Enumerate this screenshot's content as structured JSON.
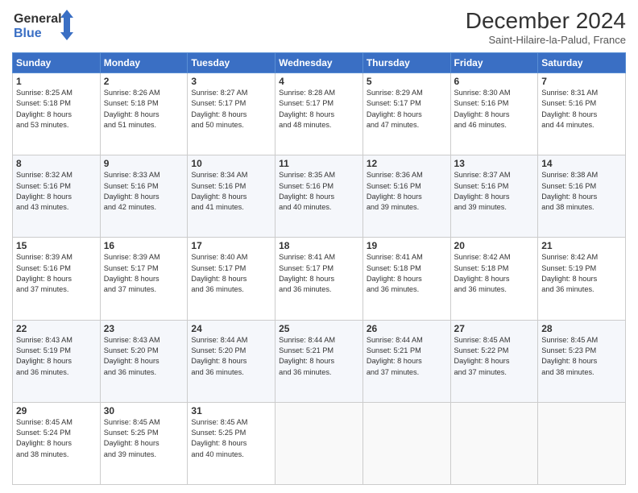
{
  "header": {
    "logo_line1": "General",
    "logo_line2": "Blue",
    "month": "December 2024",
    "location": "Saint-Hilaire-la-Palud, France"
  },
  "days_of_week": [
    "Sunday",
    "Monday",
    "Tuesday",
    "Wednesday",
    "Thursday",
    "Friday",
    "Saturday"
  ],
  "weeks": [
    [
      {
        "day": "1",
        "info": "Sunrise: 8:25 AM\nSunset: 5:18 PM\nDaylight: 8 hours\nand 53 minutes."
      },
      {
        "day": "2",
        "info": "Sunrise: 8:26 AM\nSunset: 5:18 PM\nDaylight: 8 hours\nand 51 minutes."
      },
      {
        "day": "3",
        "info": "Sunrise: 8:27 AM\nSunset: 5:17 PM\nDaylight: 8 hours\nand 50 minutes."
      },
      {
        "day": "4",
        "info": "Sunrise: 8:28 AM\nSunset: 5:17 PM\nDaylight: 8 hours\nand 48 minutes."
      },
      {
        "day": "5",
        "info": "Sunrise: 8:29 AM\nSunset: 5:17 PM\nDaylight: 8 hours\nand 47 minutes."
      },
      {
        "day": "6",
        "info": "Sunrise: 8:30 AM\nSunset: 5:16 PM\nDaylight: 8 hours\nand 46 minutes."
      },
      {
        "day": "7",
        "info": "Sunrise: 8:31 AM\nSunset: 5:16 PM\nDaylight: 8 hours\nand 44 minutes."
      }
    ],
    [
      {
        "day": "8",
        "info": "Sunrise: 8:32 AM\nSunset: 5:16 PM\nDaylight: 8 hours\nand 43 minutes."
      },
      {
        "day": "9",
        "info": "Sunrise: 8:33 AM\nSunset: 5:16 PM\nDaylight: 8 hours\nand 42 minutes."
      },
      {
        "day": "10",
        "info": "Sunrise: 8:34 AM\nSunset: 5:16 PM\nDaylight: 8 hours\nand 41 minutes."
      },
      {
        "day": "11",
        "info": "Sunrise: 8:35 AM\nSunset: 5:16 PM\nDaylight: 8 hours\nand 40 minutes."
      },
      {
        "day": "12",
        "info": "Sunrise: 8:36 AM\nSunset: 5:16 PM\nDaylight: 8 hours\nand 39 minutes."
      },
      {
        "day": "13",
        "info": "Sunrise: 8:37 AM\nSunset: 5:16 PM\nDaylight: 8 hours\nand 39 minutes."
      },
      {
        "day": "14",
        "info": "Sunrise: 8:38 AM\nSunset: 5:16 PM\nDaylight: 8 hours\nand 38 minutes."
      }
    ],
    [
      {
        "day": "15",
        "info": "Sunrise: 8:39 AM\nSunset: 5:16 PM\nDaylight: 8 hours\nand 37 minutes."
      },
      {
        "day": "16",
        "info": "Sunrise: 8:39 AM\nSunset: 5:17 PM\nDaylight: 8 hours\nand 37 minutes."
      },
      {
        "day": "17",
        "info": "Sunrise: 8:40 AM\nSunset: 5:17 PM\nDaylight: 8 hours\nand 36 minutes."
      },
      {
        "day": "18",
        "info": "Sunrise: 8:41 AM\nSunset: 5:17 PM\nDaylight: 8 hours\nand 36 minutes."
      },
      {
        "day": "19",
        "info": "Sunrise: 8:41 AM\nSunset: 5:18 PM\nDaylight: 8 hours\nand 36 minutes."
      },
      {
        "day": "20",
        "info": "Sunrise: 8:42 AM\nSunset: 5:18 PM\nDaylight: 8 hours\nand 36 minutes."
      },
      {
        "day": "21",
        "info": "Sunrise: 8:42 AM\nSunset: 5:19 PM\nDaylight: 8 hours\nand 36 minutes."
      }
    ],
    [
      {
        "day": "22",
        "info": "Sunrise: 8:43 AM\nSunset: 5:19 PM\nDaylight: 8 hours\nand 36 minutes."
      },
      {
        "day": "23",
        "info": "Sunrise: 8:43 AM\nSunset: 5:20 PM\nDaylight: 8 hours\nand 36 minutes."
      },
      {
        "day": "24",
        "info": "Sunrise: 8:44 AM\nSunset: 5:20 PM\nDaylight: 8 hours\nand 36 minutes."
      },
      {
        "day": "25",
        "info": "Sunrise: 8:44 AM\nSunset: 5:21 PM\nDaylight: 8 hours\nand 36 minutes."
      },
      {
        "day": "26",
        "info": "Sunrise: 8:44 AM\nSunset: 5:21 PM\nDaylight: 8 hours\nand 37 minutes."
      },
      {
        "day": "27",
        "info": "Sunrise: 8:45 AM\nSunset: 5:22 PM\nDaylight: 8 hours\nand 37 minutes."
      },
      {
        "day": "28",
        "info": "Sunrise: 8:45 AM\nSunset: 5:23 PM\nDaylight: 8 hours\nand 38 minutes."
      }
    ],
    [
      {
        "day": "29",
        "info": "Sunrise: 8:45 AM\nSunset: 5:24 PM\nDaylight: 8 hours\nand 38 minutes."
      },
      {
        "day": "30",
        "info": "Sunrise: 8:45 AM\nSunset: 5:25 PM\nDaylight: 8 hours\nand 39 minutes."
      },
      {
        "day": "31",
        "info": "Sunrise: 8:45 AM\nSunset: 5:25 PM\nDaylight: 8 hours\nand 40 minutes."
      },
      null,
      null,
      null,
      null
    ]
  ]
}
